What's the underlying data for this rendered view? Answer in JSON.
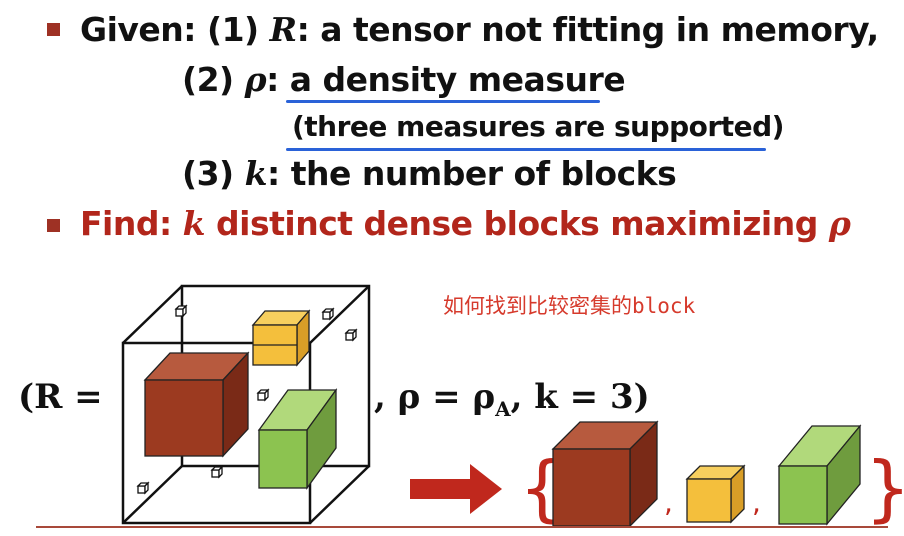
{
  "colors": {
    "bullet": "#9e3124",
    "accent_red": "#b2261b",
    "underline": "#2a62d8",
    "cube_brown": "#9c3a20",
    "cube_yellow": "#f4bf3c",
    "cube_green": "#8cc350",
    "arrow": "#c0281d",
    "baseline": "#a8493a"
  },
  "given": {
    "label": "Given:",
    "item1": {
      "num": "(1)",
      "var": "R",
      "desc": ": a tensor not fitting in memory,"
    },
    "item2": {
      "num": "(2)",
      "var": "ρ",
      "colon": ":",
      "desc": "a density measure"
    },
    "item2_note": "(three measures are supported)",
    "item3": {
      "num": "(3)",
      "var": "k",
      "desc": ": the number of blocks"
    }
  },
  "find": {
    "label": "Find:",
    "var_k": "k",
    "desc": "distinct dense blocks maximizing",
    "var_rho": "ρ"
  },
  "formula": {
    "left": "(R =",
    "right": ", ρ = ρ",
    "subscript": "A",
    "tail": ", k = 3)"
  },
  "annotation": {
    "chinese": "如何找到比较密集的",
    "latin": "block"
  },
  "output_set": {
    "open": "{",
    "sep1": ",",
    "sep2": ",",
    "close": "}"
  },
  "icons": [
    "square-bullet-icon",
    "right-arrow-icon",
    "cube-icon"
  ]
}
